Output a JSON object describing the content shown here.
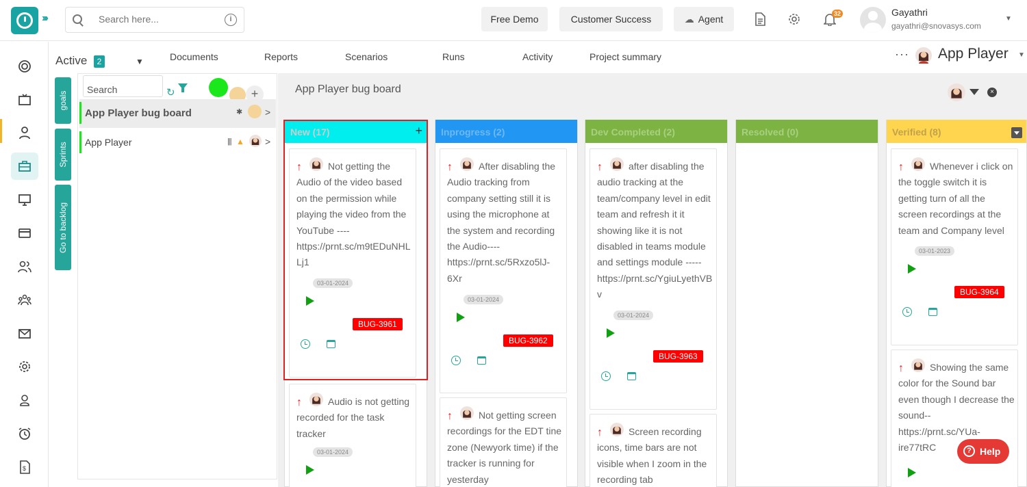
{
  "topbar": {
    "search_placeholder": "Search here...",
    "free_demo": "Free Demo",
    "customer_success": "Customer Success",
    "agent": "Agent",
    "notification_count": "32",
    "user_name": "Gayathri",
    "user_email": "gayathri@snovasys.com"
  },
  "subnav": {
    "active_label": "Active",
    "active_count": "2",
    "tabs": [
      "Documents",
      "Reports",
      "Scenarios",
      "Runs",
      "Activity",
      "Project summary"
    ],
    "project_title": "App Player"
  },
  "side_tabs": [
    "goals",
    "Sprints",
    "Go to backlog"
  ],
  "list": {
    "search_placeholder": "Search",
    "boards": [
      "App Player bug board",
      "App Player"
    ]
  },
  "board": {
    "title": "App Player bug board",
    "columns": [
      {
        "name": "New (17)",
        "color": "#00eeee",
        "cards": [
          {
            "text": "Not getting the Audio of the video based on the permission while playing the video from the YouTube ---- https://prnt.sc/m9tEDuNHLLj1",
            "date": "03-01-2024",
            "bug": "BUG-3961"
          },
          {
            "text": "Audio is not getting recorded for the task tracker",
            "date": "03-01-2024"
          }
        ]
      },
      {
        "name": "Inprogress (2)",
        "color": "#2196f3",
        "cards": [
          {
            "text": "After disabling the Audio tracking from company setting still it is using the microphone at the system and recording the Audio---- https://prnt.sc/5Rxzo5lJ-6Xr",
            "date": "03-01-2024",
            "bug": "BUG-3962"
          },
          {
            "text": "Not getting screen recordings for the EDT tine zone (Newyork time) if the tracker is running for yesterday"
          }
        ]
      },
      {
        "name": "Dev Completed (2)",
        "color": "#7cb342",
        "cards": [
          {
            "text": "after disabling the audio tracking at the team/company level in edit team and refresh it it showing like it is not disabled in teams module and settings module ----- https://prnt.sc/YgiuLyethVBv",
            "date": "03-01-2024",
            "bug": "BUG-3963"
          },
          {
            "text": "Screen recording icons, time bars are not visible when I zoom in the recording tab"
          }
        ]
      },
      {
        "name": "Resolved (0)",
        "color": "#7cb342",
        "cards": []
      },
      {
        "name": "Verified (8)",
        "color": "#ffd54f",
        "cards": [
          {
            "text": "Whenever i click on the toggle switch it is getting turn of all the screen recordings at the team and Company level",
            "date": "03-01-2023",
            "bug": "BUG-3964"
          },
          {
            "text": "Showing the same color for the Sound bar even though I decrease the sound-- https://prnt.sc/YUa-ire77tRC"
          }
        ]
      }
    ]
  },
  "help": {
    "label": "Help"
  }
}
